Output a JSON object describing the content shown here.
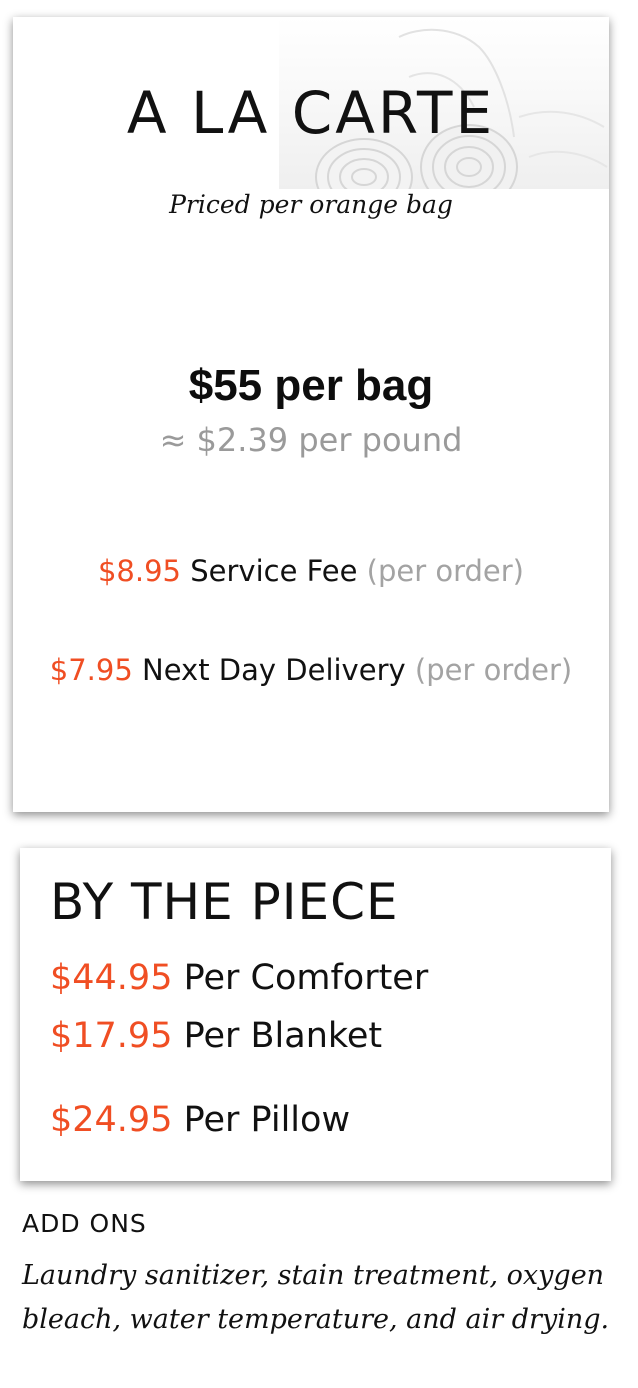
{
  "a_la_carte": {
    "title": "A LA CARTE",
    "subtitle": "Priced per orange bag",
    "main_price": "$55 per bag",
    "per_pound": "≈ $2.39 per pound",
    "fees": [
      {
        "price": "$8.95",
        "label": "Service Fee",
        "note": "(per order)"
      },
      {
        "price": "$7.95",
        "label": "Next Day Delivery",
        "note": "(per order)"
      }
    ],
    "image": "towels-image"
  },
  "by_the_piece": {
    "title": "BY THE PIECE",
    "items": [
      {
        "price": "$44.95",
        "label": "Per Comforter"
      },
      {
        "price": "$17.95",
        "label": "Per Blanket"
      },
      {
        "price": "$24.95",
        "label": "Per Pillow"
      }
    ]
  },
  "add_ons": {
    "title": "ADD ONS",
    "text": "Laundry sanitizer, stain treatment, oxygen bleach, water temperature, and air drying."
  },
  "colors": {
    "accent": "#f04e23",
    "muted": "#a3a3a3",
    "text": "#111111"
  }
}
